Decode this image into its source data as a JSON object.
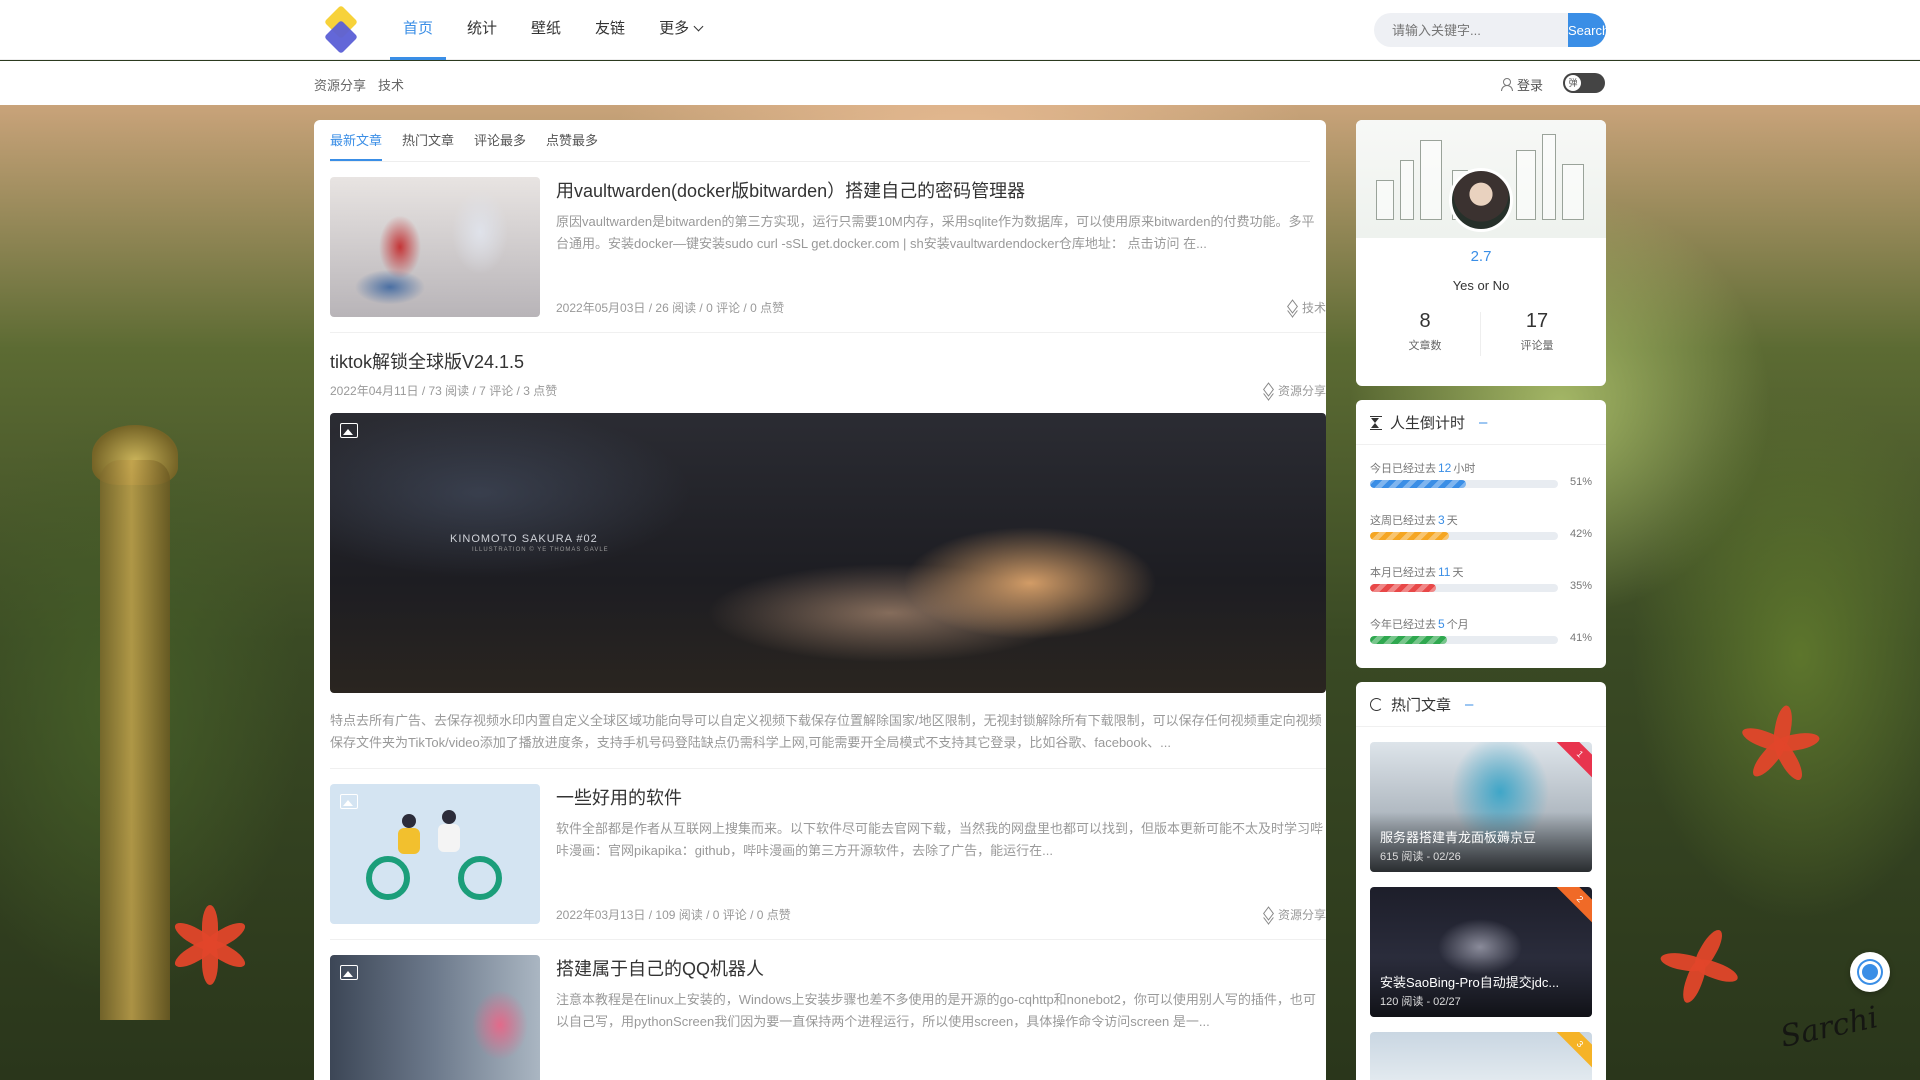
{
  "header": {
    "nav": [
      {
        "label": "首页",
        "active": true
      },
      {
        "label": "统计"
      },
      {
        "label": "壁纸"
      },
      {
        "label": "友链"
      },
      {
        "label": "更多"
      }
    ],
    "search_placeholder": "请输入关键字...",
    "search_button": "Search"
  },
  "subnav": {
    "crumbs": [
      "资源分享",
      "技术"
    ],
    "login": "登录",
    "toggle_label": "弹"
  },
  "tabs": [
    "最新文章",
    "热门文章",
    "评论最多",
    "点赞最多"
  ],
  "posts": [
    {
      "title": "用vaultwarden(docker版bitwarden）搭建自己的密码管理器",
      "excerpt": "原因vaultwarden是bitwarden的第三方实现，运行只需要10M内存，采用sqlite作为数据库，可以使用原来bitwarden的付费功能。多平台通用。安装docker—键安装sudo curl -sSL get.docker.com | sh安装vaultwardendocker仓库地址： 点击访问 在...",
      "meta": "2022年05月03日 / 26 阅读 / 0 评论 / 0 点赞",
      "tag": "技术"
    },
    {
      "title": "tiktok解锁全球版V24.1.5",
      "meta": "2022年04月11日 / 73 阅读 / 7 评论 / 3 点赞",
      "tag": "资源分享",
      "image_caption": "KINOMOTO SAKURA #02",
      "image_caption_small": "ILLUSTRATION © YE THOMAS GAVLE",
      "excerpt": "特点去所有广告、去保存视频水印内置自定义全球区域功能向导可以自定义视频下载保存位置解除国家/地区限制，无视封锁解除所有下载限制，可以保存任何视频重定向视频保存文件夹为TikTok/video添加了播放进度条，支持手机号码登陆缺点仍需科学上网,可能需要开全局模式不支持其它登录，比如谷歌、facebook、..."
    },
    {
      "title": "一些好用的软件",
      "excerpt": "软件全部都是作者从互联网上搜集而来。以下软件尽可能去官网下载，当然我的网盘里也都可以找到，但版本更新可能不太及时学习哔咔漫画：官网pikapika：github，哔咔漫画的第三方开源软件，去除了广告，能运行在...",
      "meta": "2022年03月13日 / 109 阅读 / 0 评论 / 0 点赞",
      "tag": "资源分享"
    },
    {
      "title": "搭建属于自己的QQ机器人",
      "excerpt": "注意本教程是在linux上安装的，Windows上安装步骤也差不多使用的是开源的go-cqhttp和nonebot2，你可以使用别人写的插件，也可以自己写，用pythonScreen我们因为要一直保持两个进程运行，所以使用screen，具体操作命令访问screen 是一..."
    }
  ],
  "profile": {
    "name": "2.7",
    "motto": "Yes or No",
    "stats": [
      {
        "num": "8",
        "label": "文章数"
      },
      {
        "num": "17",
        "label": "评论量"
      }
    ]
  },
  "countdown": {
    "title": "人生倒计时",
    "items": [
      {
        "prefix": "今日已经过去",
        "value": "12",
        "unit": "小时",
        "pct": 51,
        "pct_label": "51%",
        "color": "#3a8ee6"
      },
      {
        "prefix": "这周已经过去",
        "value": "3",
        "unit": "天",
        "pct": 42,
        "pct_label": "42%",
        "color": "#f5a623"
      },
      {
        "prefix": "本月已经过去",
        "value": "11",
        "unit": "天",
        "pct": 35,
        "pct_label": "35%",
        "color": "#e84848"
      },
      {
        "prefix": "今年已经过去",
        "value": "5",
        "unit": "个月",
        "pct": 41,
        "pct_label": "41%",
        "color": "#2fa84f"
      }
    ]
  },
  "hot": {
    "title": "热门文章",
    "items": [
      {
        "caption": "服务器搭建青龙面板薅京豆",
        "sub": "615 阅读 - 02/26",
        "rank": "1",
        "ribbon_color": "#e8344e"
      },
      {
        "caption": "安装SaoBing-Pro自动提交jdc...",
        "sub": "120 阅读 - 02/27",
        "rank": "2",
        "ribbon_color": "#f06a27"
      },
      {
        "rank": "3",
        "ribbon_color": "#f5b327"
      }
    ]
  },
  "signature": "Sarchi"
}
